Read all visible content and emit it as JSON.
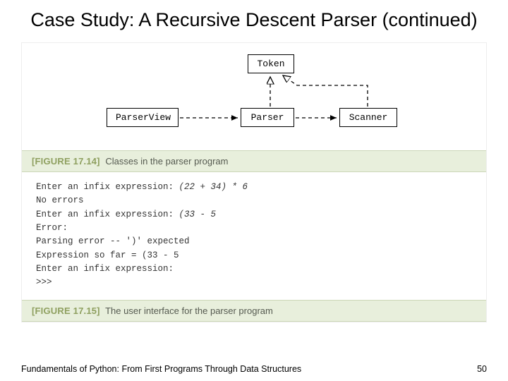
{
  "title": "Case Study: A Recursive Descent Parser (continued)",
  "diagram": {
    "nodes": {
      "token": "Token",
      "parserview": "ParserView",
      "parser": "Parser",
      "scanner": "Scanner"
    }
  },
  "figure14": {
    "label": "[FIGURE 17.14]",
    "caption": "Classes in the parser program"
  },
  "console": {
    "l1a": "Enter an infix expression: ",
    "l1b": "(22 + 34) * 6",
    "l2": "No errors",
    "l3a": "Enter an infix expression: ",
    "l3b": "(33 - 5",
    "l4": "Error:",
    "l5": "Parsing error -- ')' expected",
    "l6": "Expression so far = (33 - 5",
    "l7": "Enter an infix expression:",
    "l8": ">>>"
  },
  "figure15": {
    "label": "[FIGURE 17.15]",
    "caption": "The user interface for the parser program"
  },
  "footer": {
    "book": "Fundamentals of Python: From First Programs Through Data Structures",
    "page": "50"
  }
}
